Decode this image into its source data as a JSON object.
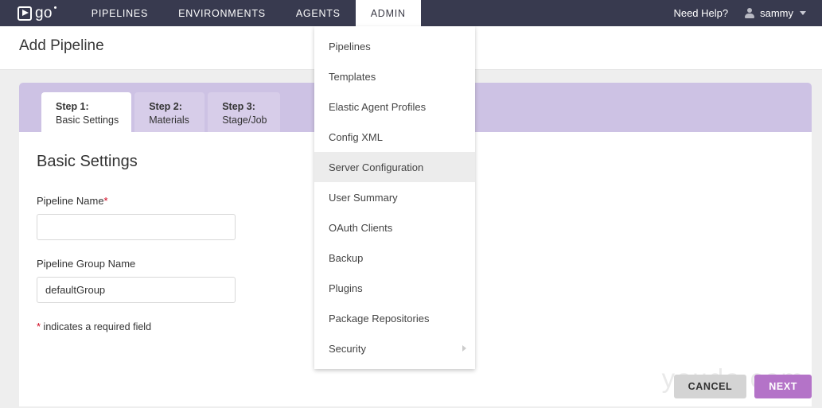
{
  "brand": {
    "logo_text": "go",
    "logo_icon": "play-triangle-logo-icon"
  },
  "topnav": {
    "items": [
      {
        "label": "PIPELINES",
        "active": false
      },
      {
        "label": "ENVIRONMENTS",
        "active": false
      },
      {
        "label": "AGENTS",
        "active": false
      },
      {
        "label": "ADMIN",
        "active": true
      }
    ],
    "need_help": "Need Help?",
    "user": {
      "name": "sammy",
      "icon": "user-avatar-icon",
      "caret": "chevron-down-icon"
    }
  },
  "admin_dropdown": {
    "items": [
      {
        "label": "Pipelines",
        "highlighted": false,
        "has_submenu": false
      },
      {
        "label": "Templates",
        "highlighted": false,
        "has_submenu": false
      },
      {
        "label": "Elastic Agent Profiles",
        "highlighted": false,
        "has_submenu": false
      },
      {
        "label": "Config XML",
        "highlighted": false,
        "has_submenu": false
      },
      {
        "label": "Server Configuration",
        "highlighted": true,
        "has_submenu": false
      },
      {
        "label": "User Summary",
        "highlighted": false,
        "has_submenu": false
      },
      {
        "label": "OAuth Clients",
        "highlighted": false,
        "has_submenu": false
      },
      {
        "label": "Backup",
        "highlighted": false,
        "has_submenu": false
      },
      {
        "label": "Plugins",
        "highlighted": false,
        "has_submenu": false
      },
      {
        "label": "Package Repositories",
        "highlighted": false,
        "has_submenu": false
      },
      {
        "label": "Security",
        "highlighted": false,
        "has_submenu": true
      }
    ]
  },
  "page": {
    "title": "Add Pipeline"
  },
  "wizard": {
    "tabs": [
      {
        "step": "Step 1:",
        "name": "Basic Settings",
        "active": true
      },
      {
        "step": "Step 2:",
        "name": "Materials",
        "active": false
      },
      {
        "step": "Step 3:",
        "name": "Stage/Job",
        "active": false
      }
    ],
    "heading": "Basic Settings",
    "fields": {
      "pipeline_name": {
        "label": "Pipeline Name",
        "required_marker": "*",
        "value": "",
        "placeholder": ""
      },
      "pipeline_group_name": {
        "label": "Pipeline Group Name",
        "required_marker": "",
        "value": "defaultGroup",
        "placeholder": ""
      }
    },
    "required_note_marker": "*",
    "required_note_text": " indicates a required field"
  },
  "footer": {
    "cancel_label": "CANCEL",
    "next_label": "NEXT"
  },
  "watermark": {
    "text": "youda.com"
  },
  "colors": {
    "nav_background": "#383a4f",
    "wizard_bar": "#cdc2e4",
    "tab_inactive": "#d7cde9",
    "primary_button": "#b473c8",
    "cancel_button": "#d4d4d4",
    "required_star": "#d0021b",
    "page_background": "#eeeeee"
  }
}
